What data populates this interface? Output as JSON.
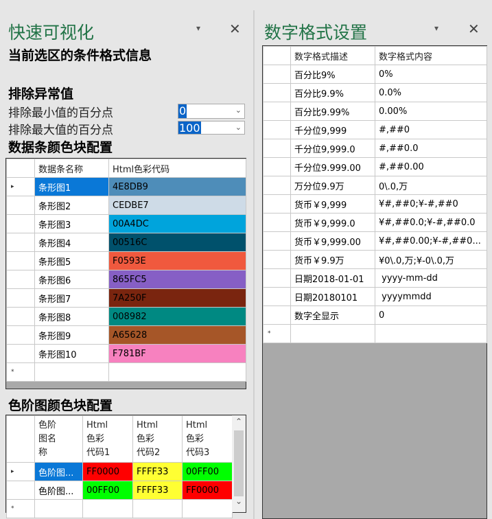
{
  "left_panel": {
    "title": "快速可视化",
    "subtitle": "当前选区的条件格式信息",
    "outlier_section": "排除异常值",
    "min_label": "排除最小值的百分点",
    "min_value": "0",
    "max_label": "排除最大值的百分点",
    "max_value": "100",
    "databar_section": "数据条颜色块配置",
    "databar_headers": [
      "数据条名称",
      "Html色彩代码"
    ],
    "databar_rows": [
      {
        "name": "条形图1",
        "code": "4E8DB9",
        "color": "#4E8DB9"
      },
      {
        "name": "条形图2",
        "code": "CEDBE7",
        "color": "#CEDBE7"
      },
      {
        "name": "条形图3",
        "code": "00A4DC",
        "color": "#00A4DC"
      },
      {
        "name": "条形图4",
        "code": "00516C",
        "color": "#00516C"
      },
      {
        "name": "条形图5",
        "code": "F0593E",
        "color": "#F0593E"
      },
      {
        "name": "条形图6",
        "code": "865FC5",
        "color": "#865FC5"
      },
      {
        "name": "条形图7",
        "code": "7A250F",
        "color": "#7A250F"
      },
      {
        "name": "条形图8",
        "code": "008982",
        "color": "#008982"
      },
      {
        "name": "条形图9",
        "code": "A65628",
        "color": "#A65628"
      },
      {
        "name": "条形图10",
        "code": "F781BF",
        "color": "#F781BF"
      }
    ],
    "scale_section": "色阶图颜色块配置",
    "scale_headers": [
      "色阶图名称",
      "Html色彩代码1",
      "Html色彩代码2",
      "Html色彩代码3"
    ],
    "scale_rows": [
      {
        "name": "色阶图...",
        "c1": "FF0000",
        "c2": "FFFF33",
        "c3": "00FF00",
        "bg1": "#FF0000",
        "bg2": "#FFFF33",
        "bg3": "#00FF00"
      },
      {
        "name": "色阶图...",
        "c1": "00FF00",
        "c2": "FFFF33",
        "c3": "FF0000",
        "bg1": "#00FF00",
        "bg2": "#FFFF33",
        "bg3": "#FF0000"
      }
    ]
  },
  "right_panel": {
    "title": "数字格式设置",
    "headers": [
      "数字格式描述",
      "数字格式内容"
    ],
    "rows": [
      [
        "百分比9%",
        "0%"
      ],
      [
        "百分比9.9%",
        "0.0%"
      ],
      [
        "百分比9.99%",
        "0.00%"
      ],
      [
        "千分位9,999",
        "#,##0"
      ],
      [
        "千分位9,999.0",
        "#,##0.0"
      ],
      [
        "千分位9.999.00",
        "#,##0.00"
      ],
      [
        "万分位9.9万",
        "0\\.0,万"
      ],
      [
        "货币￥9,999",
        "¥#,##0;¥-#,##0"
      ],
      [
        "货币￥9,999.0",
        "¥#,##0.0;¥-#,##0.0"
      ],
      [
        "货币￥9,999.00",
        "¥#,##0.00;¥-#,##0..."
      ],
      [
        "货币￥9.9万",
        "¥0\\.0,万;¥-0\\.0,万"
      ],
      [
        "日期2018-01-01",
        " yyyy-mm-dd"
      ],
      [
        "日期20180101",
        " yyyymmdd"
      ],
      [
        "数字全显示",
        "0"
      ]
    ]
  },
  "icons": {
    "pin": "▾",
    "close": "✕",
    "current_row": "▸",
    "new_row": "*",
    "up": "⌃",
    "down": "⌄",
    "chev": "⌄"
  }
}
